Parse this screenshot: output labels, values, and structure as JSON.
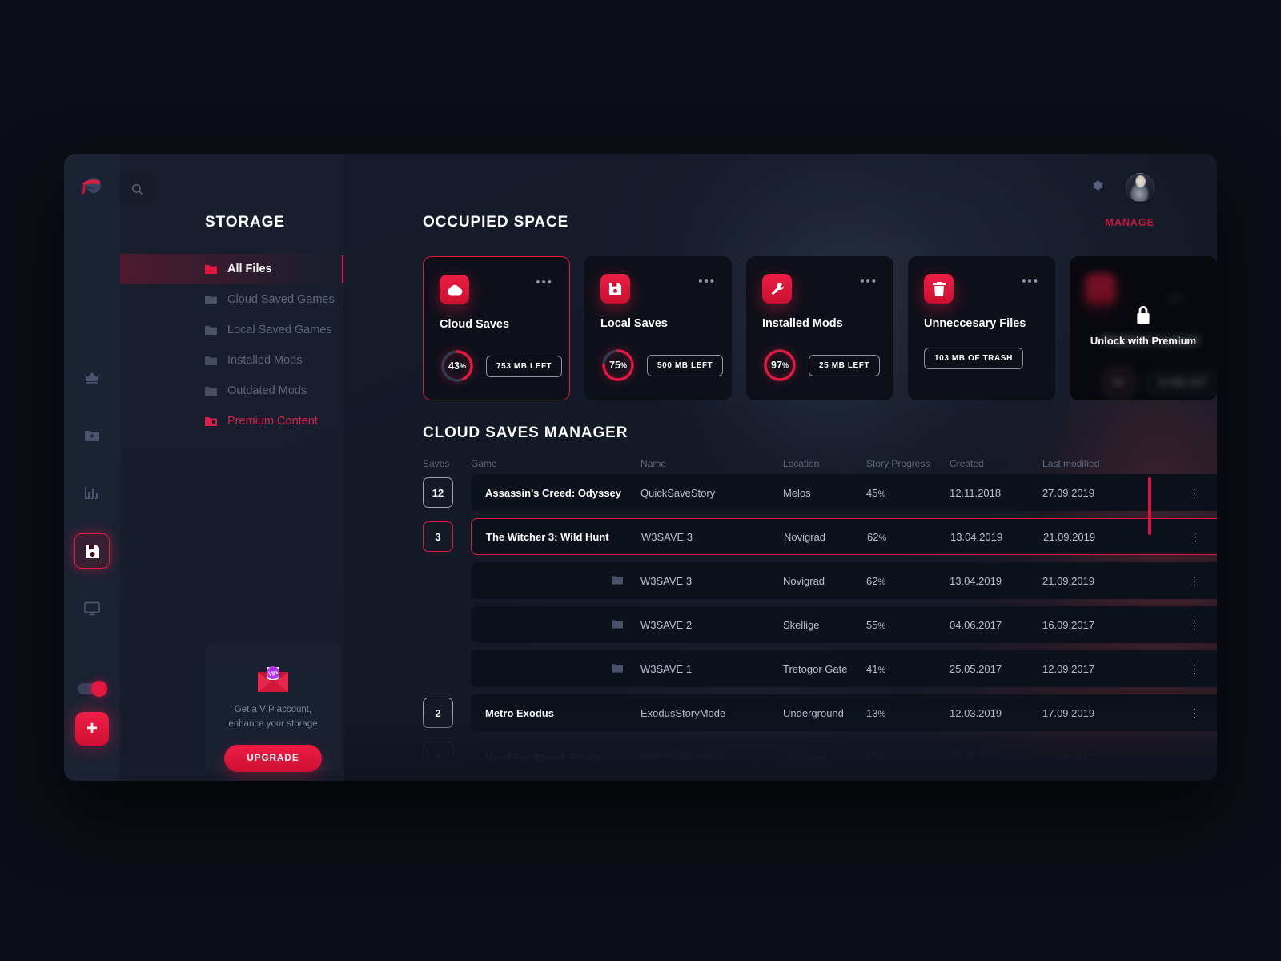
{
  "app": {
    "logo_icon": "ninja-head-logo"
  },
  "rail": {
    "icons": [
      {
        "name": "crown-icon",
        "label": "Premium"
      },
      {
        "name": "folder-download-icon",
        "label": "Downloads"
      },
      {
        "name": "chart-bar-icon",
        "label": "Statistics"
      },
      {
        "name": "save-disk-icon",
        "label": "Saves",
        "active": true
      },
      {
        "name": "monitor-icon",
        "label": "Devices"
      }
    ],
    "toggle_on": true,
    "add_label": "+"
  },
  "sidebar": {
    "search_placeholder": "Search",
    "title": "STORAGE",
    "items": [
      {
        "label": "All Files",
        "active": true
      },
      {
        "label": "Cloud Saved Games",
        "active": false
      },
      {
        "label": "Local Saved Games",
        "active": false
      },
      {
        "label": "Installed Mods",
        "active": false
      },
      {
        "label": "Outdated Mods",
        "active": false
      },
      {
        "label": "Premium Content",
        "active": false,
        "premium": true
      }
    ],
    "vip": {
      "badge": "VIP",
      "line1": "Get a VIP account,",
      "line2": "enhance your storage",
      "button": "UPGRADE"
    }
  },
  "header": {
    "gear_icon": "gear-icon",
    "avatar": "user-avatar"
  },
  "occupied": {
    "title": "OCCUPIED SPACE",
    "manage": "MANAGE",
    "cards": [
      {
        "icon": "cloud-icon",
        "name": "Cloud Saves",
        "percent": 43,
        "percent_label": "43",
        "pill": "753 MB LEFT",
        "selected": true,
        "locked": false
      },
      {
        "icon": "floppy-disk-icon",
        "name": "Local Saves",
        "percent": 75,
        "percent_label": "75",
        "pill": "500 MB LEFT",
        "selected": false,
        "locked": false
      },
      {
        "icon": "wrench-icon",
        "name": "Installed Mods",
        "percent": 97,
        "percent_label": "97",
        "pill": "25 MB LEFT",
        "selected": false,
        "locked": false
      },
      {
        "icon": "trash-icon",
        "name": "Unneccesary Files",
        "percent": null,
        "percent_label": "",
        "pill": "103 MB OF TRASH",
        "selected": false,
        "locked": false
      },
      {
        "icon": "lock-icon",
        "name": "Premium Content",
        "percent": 0,
        "percent_label": "0",
        "pill": "00 MB LEFT",
        "selected": false,
        "locked": true,
        "lock_label": "Unlock with Premium"
      }
    ]
  },
  "cloud_saves": {
    "title": "CLOUD SAVES MANAGER",
    "columns": [
      "Saves",
      "Game",
      "Name",
      "Location",
      "Story Progress",
      "Created",
      "Last modified"
    ],
    "rows": [
      {
        "saves": "12",
        "game": "Assassin's Creed: Odyssey",
        "name": "QuickSaveStory",
        "location": "Melos",
        "progress": "45",
        "created": "12.11.2018",
        "modified": "27.09.2019",
        "selected": false,
        "faded": false,
        "sub": false
      },
      {
        "saves": "3",
        "game": "The Witcher 3: Wild Hunt",
        "name": "W3SAVE 3",
        "location": "Novigrad",
        "progress": "62",
        "created": "13.04.2019",
        "modified": "21.09.2019",
        "selected": true,
        "faded": false,
        "sub": false
      },
      {
        "saves": "",
        "game": "",
        "name": "W3SAVE 3",
        "location": "Novigrad",
        "progress": "62",
        "created": "13.04.2019",
        "modified": "21.09.2019",
        "selected": false,
        "faded": false,
        "sub": true
      },
      {
        "saves": "",
        "game": "",
        "name": "W3SAVE 2",
        "location": "Skellige",
        "progress": "55",
        "created": "04.06.2017",
        "modified": "16.09.2017",
        "selected": false,
        "faded": false,
        "sub": true
      },
      {
        "saves": "",
        "game": "",
        "name": "W3SAVE 1",
        "location": "Tretogor Gate",
        "progress": "41",
        "created": "25.05.2017",
        "modified": "12.09.2017",
        "selected": false,
        "faded": false,
        "sub": true
      },
      {
        "saves": "2",
        "game": "Metro Exodus",
        "name": "ExodusStoryMode",
        "location": "Underground",
        "progress": "13",
        "created": "12.03.2019",
        "modified": "17.09.2019",
        "selected": false,
        "faded": false,
        "sub": false
      },
      {
        "saves": "4",
        "game": "Need For Speed: Rivals",
        "name": "NFS Rivals Police",
        "location": "Unknown",
        "progress": "62",
        "created": "25.05.2017",
        "modified": "12.09.2017",
        "selected": false,
        "faded": true,
        "sub": false
      }
    ]
  },
  "colors": {
    "accent": "#e4183f",
    "accent_dark": "#c41639",
    "panel": "#0d111b",
    "sidebar": "#1b2233",
    "text": "#ffffff",
    "muted": "#5f6879"
  }
}
